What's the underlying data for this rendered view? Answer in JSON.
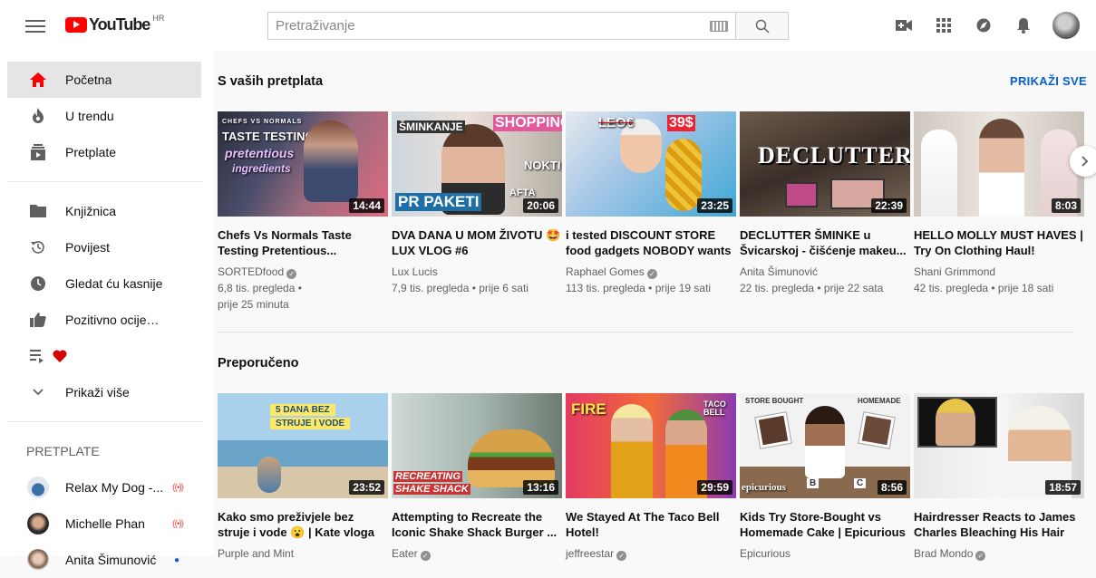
{
  "header": {
    "logo_text": "YouTube",
    "country_code": "HR",
    "search_placeholder": "Pretraživanje"
  },
  "sidebar": {
    "main_items": [
      {
        "label": "Početna",
        "icon": "home-icon"
      },
      {
        "label": "U trendu",
        "icon": "fire-icon"
      },
      {
        "label": "Pretplate",
        "icon": "subscriptions-icon"
      }
    ],
    "library_items": [
      {
        "label": "Knjižnica",
        "icon": "folder-icon"
      },
      {
        "label": "Povijest",
        "icon": "history-icon"
      },
      {
        "label": "Gledat ću kasnije",
        "icon": "clock-icon"
      },
      {
        "label": "Pozitivno ocijenje...",
        "icon": "thumbs-up-icon"
      },
      {
        "label": "",
        "icon": "playlist-icon"
      },
      {
        "label": "Prikaži više",
        "icon": "chevron-down-icon"
      }
    ],
    "subscriptions_title": "PRETPLATE",
    "subscriptions": [
      {
        "label": "Relax My Dog -...",
        "status": "live"
      },
      {
        "label": "Michelle Phan",
        "status": "live"
      },
      {
        "label": "Anita Šimunović",
        "status": "new"
      }
    ]
  },
  "subscriptions_section": {
    "title": "S vaših pretplata",
    "show_all": "PRIKAŽI SVE",
    "videos": [
      {
        "title": "Chefs Vs Normals Taste Testing Pretentious...",
        "channel": "SORTEDfood",
        "verified": true,
        "views": "6,8 tis. pregleda •",
        "age": "prije 25 minuta",
        "duration": "14:44",
        "thumb_texts": [
          "CHEFS VS NORMALS",
          "TASTE TESTING",
          "pretentious",
          "ingredients"
        ]
      },
      {
        "title": "DVA DANA U MOM ŽIVOTU 🤩 LUX VLOG #6",
        "channel": "Lux Lucis",
        "verified": false,
        "views": "7,9 tis. pregleda • prije 6 sati",
        "age": "",
        "duration": "20:06",
        "thumb_texts": [
          "ŠMINKANJE",
          "SHOPPING",
          "NOKTI",
          "PR PAKETI",
          "AFTA"
        ]
      },
      {
        "title": "i tested DISCOUNT STORE food gadgets NOBODY wants",
        "channel": "Raphael Gomes",
        "verified": true,
        "views": "113 tis. pregleda • prije 19 sati",
        "age": "",
        "duration": "23:25",
        "thumb_texts": [
          "LEO€",
          "39$"
        ]
      },
      {
        "title": "DECLUTTER ŠMINKE u Švicarskoj - čišćenje makeu...",
        "channel": "Anita Šimunović",
        "verified": false,
        "views": "22 tis. pregleda • prije 22 sata",
        "age": "",
        "duration": "22:39",
        "thumb_texts": [
          "DECLUTTER"
        ]
      },
      {
        "title": "HELLO MOLLY MUST HAVES | Try On Clothing Haul!",
        "channel": "Shani Grimmond",
        "verified": false,
        "views": "42 tis. pregleda • prije 18 sati",
        "age": "",
        "duration": "8:03",
        "thumb_texts": []
      }
    ]
  },
  "recommended_section": {
    "title": "Preporučeno",
    "videos": [
      {
        "title": "Kako smo preživjele bez struje i vode 😮 | Kate vloga",
        "channel": "Purple and Mint",
        "verified": false,
        "duration": "23:52",
        "thumb_texts": [
          "5 DANA BEZ",
          "STRUJE I VODE"
        ]
      },
      {
        "title": "Attempting to Recreate the Iconic Shake Shack Burger ...",
        "channel": "Eater",
        "verified": true,
        "duration": "13:16",
        "thumb_texts": [
          "RECREATING",
          "SHAKE SHACK"
        ]
      },
      {
        "title": "We Stayed At The Taco Bell Hotel!",
        "channel": "jeffreestar",
        "verified": true,
        "duration": "29:59",
        "thumb_texts": [
          "FIRE",
          "TACO BELL"
        ]
      },
      {
        "title": "Kids Try Store-Bought vs Homemade Cake | Epicurious",
        "channel": "Epicurious",
        "verified": false,
        "duration": "8:56",
        "thumb_texts": [
          "STORE BOUGHT",
          "HOMEMADE",
          "epicurious",
          "B",
          "C"
        ]
      },
      {
        "title": "Hairdresser Reacts to James Charles Bleaching His Hair",
        "channel": "Brad Mondo",
        "verified": true,
        "duration": "18:57",
        "thumb_texts": []
      }
    ]
  },
  "colors": {
    "accent_red": "#ff0000",
    "link_blue": "#065fd4",
    "live_red": "#ff4e45"
  }
}
